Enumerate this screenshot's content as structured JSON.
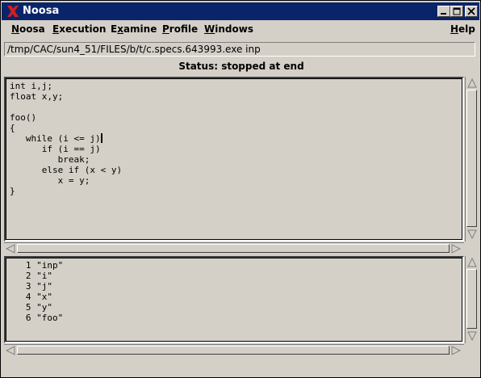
{
  "window": {
    "title": "Noosa",
    "controls": [
      "minimize-icon",
      "maximize-icon",
      "close-icon"
    ]
  },
  "menubar": {
    "items": [
      {
        "label": "Noosa",
        "underline": "N",
        "rest": "oosa"
      },
      {
        "label": "Execution",
        "underline": "E",
        "rest": "xecution"
      },
      {
        "label": "Examine",
        "pre": "E",
        "underline": "x",
        "rest": "amine"
      },
      {
        "label": "Profile",
        "underline": "P",
        "rest": "rofile"
      },
      {
        "label": "Windows",
        "underline": "W",
        "rest": "indows"
      },
      {
        "label": "Help",
        "underline": "H",
        "rest": "elp"
      }
    ]
  },
  "path": "/tmp/CAC/sun4_51/FILES/b/t/c.specs.643993.exe inp",
  "status": "Status: stopped at end",
  "source_lines": [
    "int i,j;",
    "float x,y;",
    "",
    "foo()",
    "{",
    "   while (i <= j)",
    "      if (i == j)",
    "         break;",
    "      else if (x < y)",
    "         x = y;",
    "}"
  ],
  "symbol_lines": [
    "   1 \"inp\"",
    "   2 \"i\"",
    "   3 \"j\"",
    "   4 \"x\"",
    "   5 \"y\"",
    "   6 \"foo\""
  ]
}
